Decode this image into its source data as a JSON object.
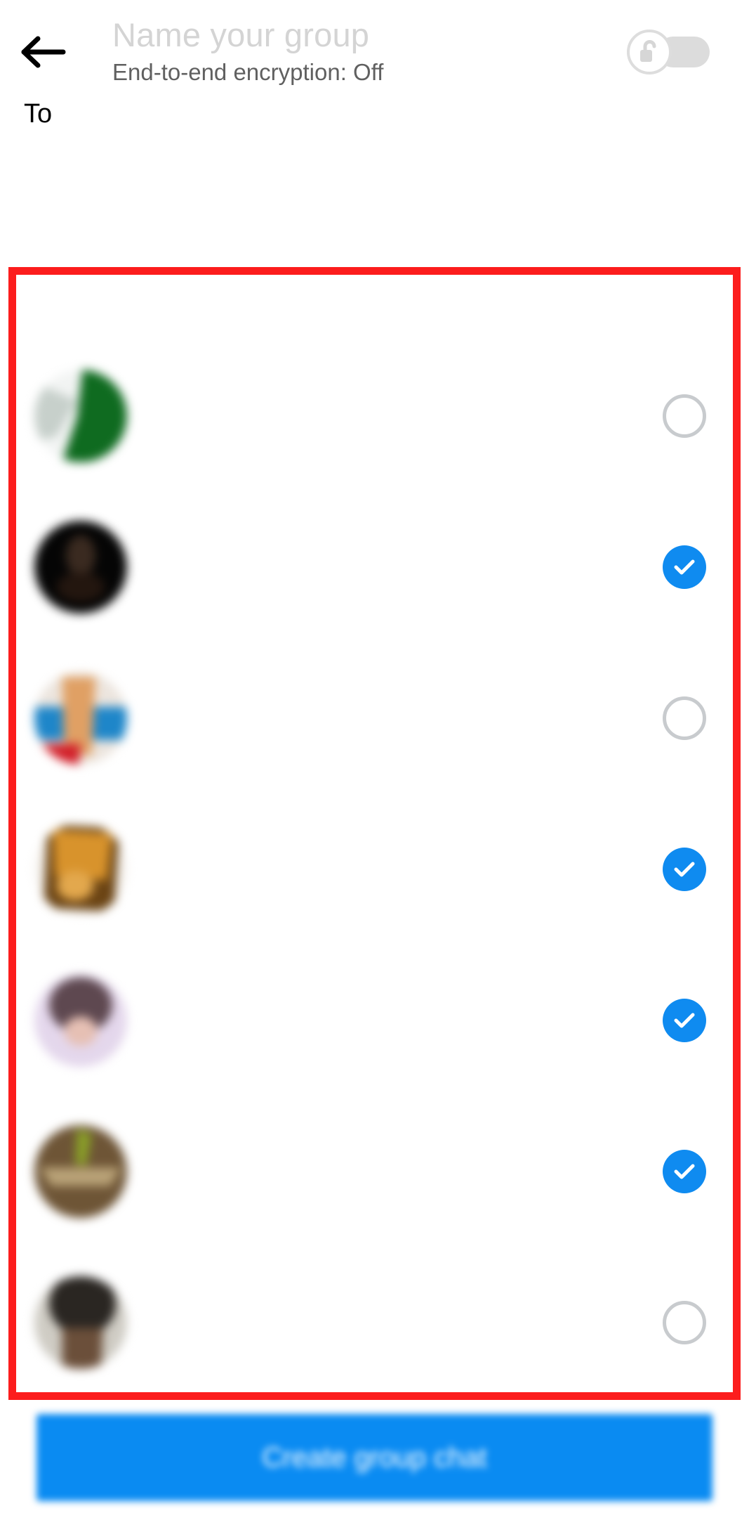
{
  "header": {
    "back_icon": "back-arrow-icon",
    "group_name_placeholder": "Name your group",
    "group_name_value": "",
    "encryption_status": "End-to-end encryption: Off",
    "toggle": {
      "name": "end-to-end-encryption-toggle",
      "state": "off",
      "icon": "unlocked-padlock-icon",
      "track_color": "#dcdcdc",
      "thumb_color": "#ffffff"
    }
  },
  "recipients": {
    "label": "To",
    "value": "",
    "placeholder": ""
  },
  "annotation": {
    "name": "red-highlight-box",
    "color": "#fc1d1d",
    "border_width": 11
  },
  "contact_list": {
    "rows": [
      {
        "name": "",
        "subtitle": "",
        "selected": false,
        "avatar": "avatar-green-white",
        "avatar_colors": [
          "#0f6b20",
          "#cfd6d2",
          "#f2f4f3"
        ]
      },
      {
        "name": "",
        "subtitle": "",
        "selected": true,
        "avatar": "avatar-dark-photo",
        "avatar_colors": [
          "#050505",
          "#2a1e18",
          "#0c0a09"
        ]
      },
      {
        "name": "",
        "subtitle": "",
        "selected": false,
        "avatar": "avatar-blue-orange-photo",
        "avatar_colors": [
          "#1e86c9",
          "#e0a064",
          "#d2202a"
        ]
      },
      {
        "name": "",
        "subtitle": "",
        "selected": true,
        "avatar": "avatar-food-photo",
        "avatar_colors": [
          "#c87f1e",
          "#6b4414",
          "#e3a84d"
        ]
      },
      {
        "name": "",
        "subtitle": "",
        "selected": true,
        "avatar": "avatar-lavender-photo",
        "avatar_colors": [
          "#e4d7ec",
          "#5e4850",
          "#e6c0b4"
        ]
      },
      {
        "name": "",
        "subtitle": "",
        "selected": true,
        "avatar": "avatar-brown-green-photo",
        "avatar_colors": [
          "#6e5536",
          "#b9a277",
          "#8aa028"
        ]
      },
      {
        "name": "",
        "subtitle": "",
        "selected": false,
        "avatar": "avatar-dark-hair-photo",
        "avatar_colors": [
          "#2a2622",
          "#b9b5ac",
          "#8a6a50"
        ]
      }
    ],
    "checked_color": "#0f8bf0",
    "unchecked_color": "#c8cbce"
  },
  "footer": {
    "create_button_label": "Create group chat",
    "create_button_color": "#0a8bf2"
  }
}
